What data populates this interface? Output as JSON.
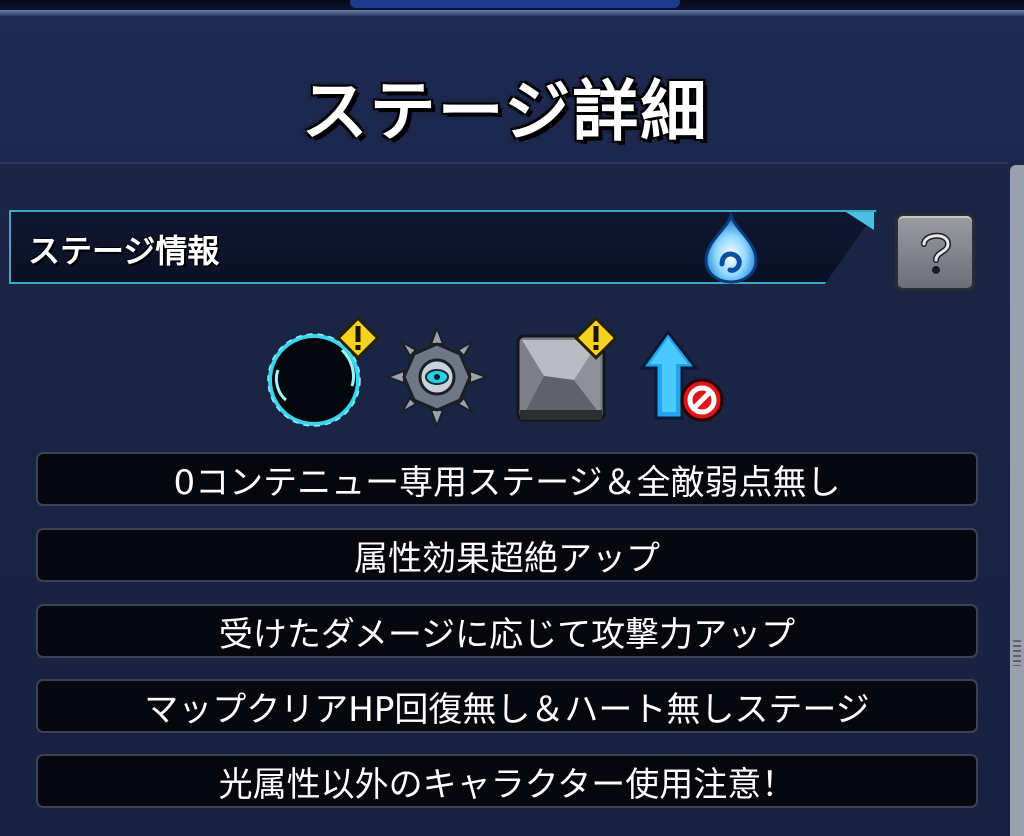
{
  "header": {
    "title": "ステージ詳細"
  },
  "stage_info": {
    "label": "ステージ情報",
    "element_icon": "water-element-icon",
    "help_icon": "question-icon"
  },
  "gimmicks": [
    {
      "icon": "dark-hole-icon",
      "warning": true
    },
    {
      "icon": "spiked-mine-icon",
      "warning": false
    },
    {
      "icon": "stone-block-icon",
      "warning": true
    },
    {
      "icon": "speed-up-prohibited-icon",
      "warning": false
    }
  ],
  "notes": [
    "0コンテニュー専用ステージ＆全敵弱点無し",
    "属性効果超絶アップ",
    "受けたダメージに応じて攻撃力アップ",
    "マップクリアHP回復無し＆ハート無しステージ",
    "光属性以外のキャラクター使用注意！"
  ],
  "colors": {
    "panel_bg": "#1a2448",
    "info_border": "#3aa8c9",
    "row_bg": "#07080d",
    "warning_yellow": "#f4d21f",
    "ban_red": "#e0141b"
  }
}
